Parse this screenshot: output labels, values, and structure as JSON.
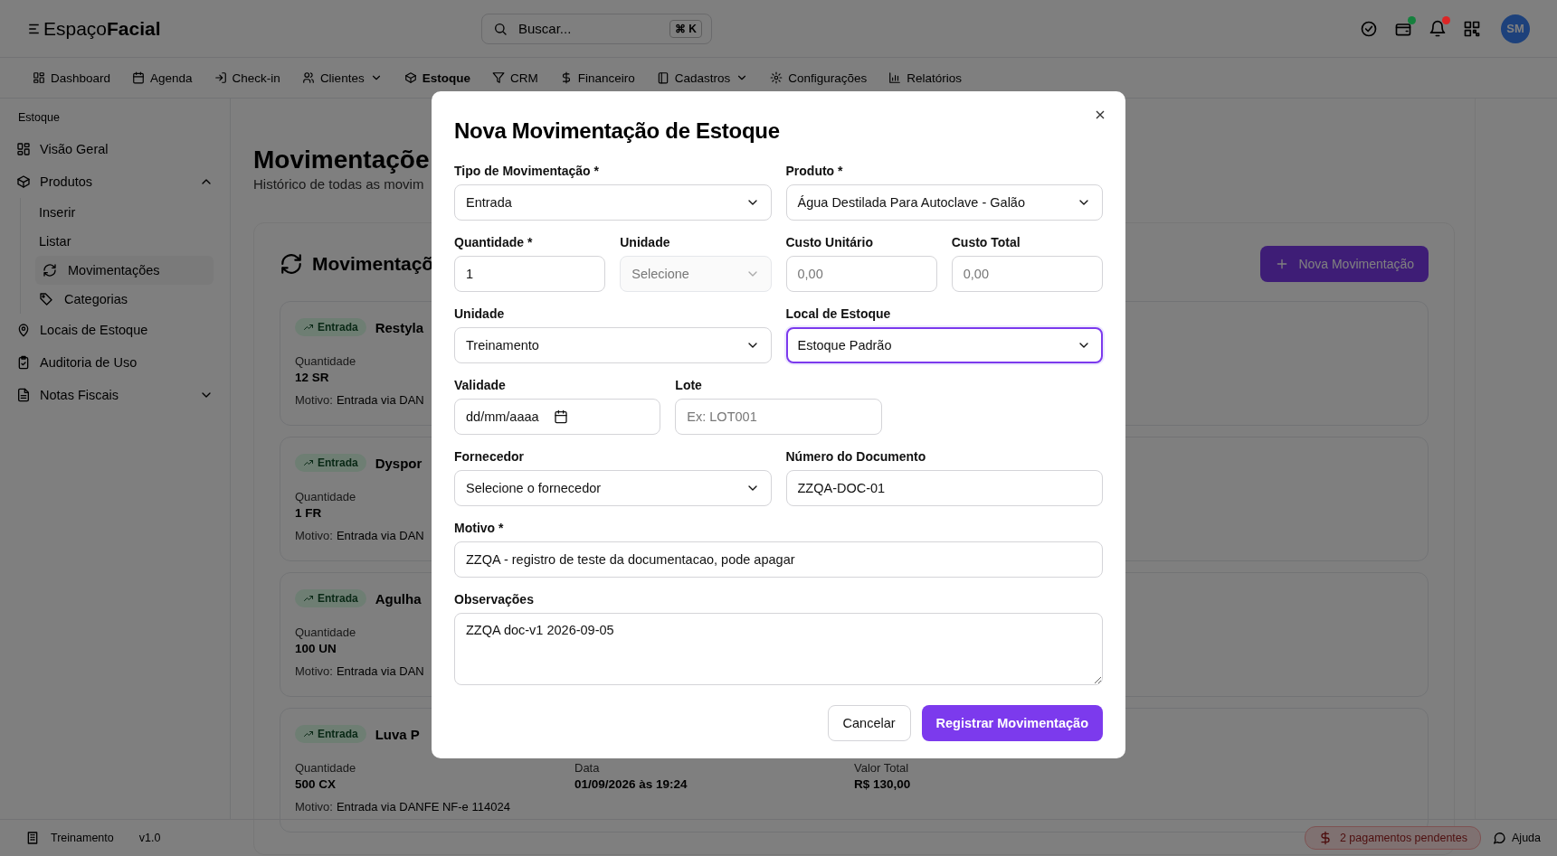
{
  "header": {
    "logo_light": "Espaço",
    "logo_bold": "Facial",
    "search": {
      "placeholder": "Buscar...",
      "shortcut": "⌘ K"
    },
    "actions": [
      {
        "has_dot": false
      },
      {
        "has_dot": true,
        "color": "#15803d"
      },
      {
        "has_dot": true,
        "color": "#dc2626"
      },
      {
        "has_dot": false
      }
    ],
    "avatar": "SM"
  },
  "nav": [
    {
      "label": "Dashboard",
      "selected": false,
      "has_caret": false
    },
    {
      "label": "Agenda",
      "selected": false,
      "has_caret": false
    },
    {
      "label": "Check-in",
      "selected": false,
      "has_caret": false
    },
    {
      "label": "Clientes",
      "selected": false,
      "has_caret": true
    },
    {
      "label": "Estoque",
      "selected": true,
      "has_caret": false
    },
    {
      "label": "CRM",
      "selected": false,
      "has_caret": false
    },
    {
      "label": "Financeiro",
      "selected": false,
      "has_caret": false
    },
    {
      "label": "Cadastros",
      "selected": false,
      "has_caret": true
    },
    {
      "label": "Configurações",
      "selected": false,
      "has_caret": false
    },
    {
      "label": "Relatórios",
      "selected": false,
      "has_caret": false
    }
  ],
  "sidebar": {
    "heading": "Estoque",
    "items": [
      {
        "label": "Visão Geral",
        "selected": false
      },
      {
        "label": "Produtos",
        "selected": false,
        "expanded": true,
        "children": [
          {
            "label": "Inserir",
            "selected": false
          },
          {
            "label": "Listar",
            "selected": false
          },
          {
            "label": "Movimentações",
            "selected": true
          },
          {
            "label": "Categorias",
            "selected": false
          }
        ]
      },
      {
        "label": "Locais de Estoque",
        "selected": false
      },
      {
        "label": "Auditoria de Uso",
        "selected": false
      },
      {
        "label": "Notas Fiscais",
        "selected": false,
        "expanded": false
      }
    ]
  },
  "page": {
    "title": "Movimentaçõe",
    "subtitle": "Histórico de todas as movim",
    "section_title": "Movimentaçõ",
    "new_button": "Nova Movimentação",
    "cards": [
      {
        "badge": "Entrada",
        "title": "Restyla",
        "quantity_label": "Quantidade",
        "quantity": "12 SR",
        "motivo_label": "Motivo:",
        "motivo": "Entrada via DAN"
      },
      {
        "badge": "Entrada",
        "title": "Dyspor",
        "quantity_label": "Quantidade",
        "quantity": "1 FR",
        "motivo_label": "Motivo:",
        "motivo": "Entrada via DAN"
      },
      {
        "badge": "Entrada",
        "title": "Agulha",
        "quantity_label": "Quantidade",
        "quantity": "100 UN",
        "motivo_label": "Motivo:",
        "motivo": "Entrada via DAN"
      },
      {
        "badge": "Entrada",
        "title": "Luva P",
        "quantity_label": "Quantidade",
        "quantity": "500 CX",
        "date_label": "Data",
        "date": "01/09/2026 às 19:24",
        "total_label": "Valor Total",
        "total": "R$ 130,00",
        "motivo_label": "Motivo:",
        "motivo": "Entrada via DANFE NF-e 114024"
      }
    ]
  },
  "modal": {
    "title": "Nova Movimentação de Estoque",
    "fields": [
      {
        "kind": "select",
        "label": "Tipo de Movimentação *",
        "value": "Entrada"
      },
      {
        "kind": "select",
        "label": "Produto *",
        "value": "Água Destilada Para Autoclave - Galão"
      },
      {
        "kind": "input",
        "label": "Quantidade *",
        "value": "1"
      },
      {
        "kind": "select",
        "label": "Unidade",
        "placeholder": "Selecione",
        "disabled": true
      },
      {
        "kind": "input",
        "label": "Custo Unitário",
        "placeholder": "0,00"
      },
      {
        "kind": "input",
        "label": "Custo Total",
        "placeholder": "0,00"
      },
      {
        "kind": "select",
        "label": "Unidade",
        "value": "Treinamento"
      },
      {
        "kind": "select",
        "label": "Local de Estoque",
        "value": "Estoque Padrão",
        "focused": true
      },
      {
        "kind": "date",
        "label": "Validade",
        "placeholder": "dd/mm/aaaa"
      },
      {
        "kind": "input",
        "label": "Lote",
        "placeholder": "Ex: LOT001"
      },
      {
        "kind": "select",
        "label": "Fornecedor",
        "value": "Selecione o fornecedor"
      },
      {
        "kind": "input",
        "label": "Número do Documento",
        "value": "ZZQA-DOC-01"
      },
      {
        "kind": "input",
        "label": "Motivo *",
        "value": "ZZQA - registro de teste da documentacao, pode apagar"
      },
      {
        "kind": "textarea",
        "label": "Observações",
        "value": "ZZQA doc-v1 2026-09-05"
      }
    ],
    "cancel": "Cancelar",
    "submit": "Registrar Movimentação"
  },
  "footer": {
    "unit": "Treinamento",
    "version": "v1.0",
    "alert": "2 pagamentos pendentes",
    "help": "Ajuda"
  }
}
